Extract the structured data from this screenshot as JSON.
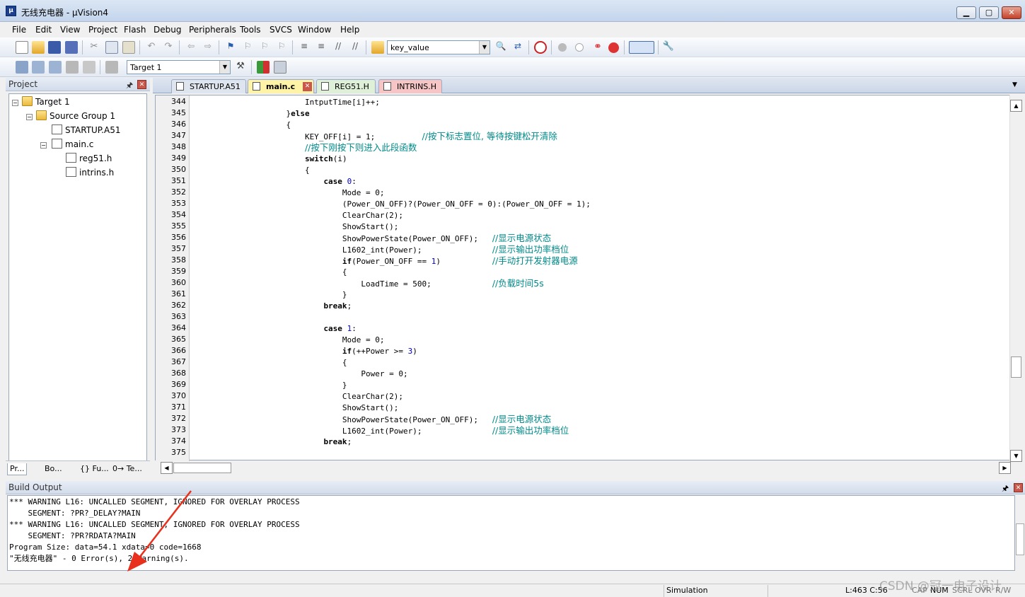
{
  "window": {
    "title": "无线充电器  - µVision4",
    "minimize": "▁",
    "maximize": "▢",
    "close": "✕"
  },
  "menu": [
    "File",
    "Edit",
    "View",
    "Project",
    "Flash",
    "Debug",
    "Peripherals",
    "Tools",
    "SVCS",
    "Window",
    "Help"
  ],
  "toolbar": {
    "find_value": "key_value",
    "target": "Target 1"
  },
  "project": {
    "title": "Project",
    "tree": {
      "target": "Target 1",
      "group": "Source Group 1",
      "file1": "STARTUP.A51",
      "file2": "main.c",
      "inc1": "reg51.h",
      "inc2": "intrins.h"
    },
    "tabs": [
      "Pr...",
      "Bo...",
      "{} Fu...",
      "0→ Te..."
    ]
  },
  "editor": {
    "tabs": [
      "STARTUP.A51",
      "main.c",
      "REG51.H",
      "INTRINS.H"
    ],
    "line_numbers": [
      "344",
      "345",
      "346",
      "347",
      "348",
      "349",
      "350",
      "351",
      "352",
      "353",
      "354",
      "355",
      "356",
      "357",
      "358",
      "359",
      "360",
      "361",
      "362",
      "363",
      "364",
      "365",
      "366",
      "367",
      "368",
      "369",
      "370",
      "371",
      "372",
      "373",
      "374",
      "375"
    ],
    "lines": [
      {
        "code": "                        IntputTime[i]++;",
        "comment": ""
      },
      {
        "code": "                    }else",
        "comment": ""
      },
      {
        "code": "                    {",
        "comment": ""
      },
      {
        "code": "                        KEY_OFF[i] = 1;          ",
        "comment": "//按下标志置位, 等待按键松开清除"
      },
      {
        "code": "                        ",
        "comment": "//按下刚按下则进入此段函数"
      },
      {
        "code": "                        switch(i)",
        "comment": ""
      },
      {
        "code": "                        {",
        "comment": ""
      },
      {
        "code": "                            case 0:",
        "comment": ""
      },
      {
        "code": "                                Mode = 0;",
        "comment": ""
      },
      {
        "code": "                                (Power_ON_OFF)?(Power_ON_OFF = 0):(Power_ON_OFF = 1);",
        "comment": ""
      },
      {
        "code": "                                ClearChar(2);",
        "comment": ""
      },
      {
        "code": "                                ShowStart();",
        "comment": ""
      },
      {
        "code": "                                ShowPowerState(Power_ON_OFF);   ",
        "comment": "//显示电源状态"
      },
      {
        "code": "                                L1602_int(Power);               ",
        "comment": "//显示输出功率档位"
      },
      {
        "code": "                                if(Power_ON_OFF == 1)           ",
        "comment": "//手动打开发射器电源"
      },
      {
        "code": "                                {",
        "comment": ""
      },
      {
        "code": "                                    LoadTime = 500;             ",
        "comment": "//负载时间5s"
      },
      {
        "code": "                                }",
        "comment": ""
      },
      {
        "code": "                            break;",
        "comment": ""
      },
      {
        "code": "",
        "comment": ""
      },
      {
        "code": "                            case 1:",
        "comment": ""
      },
      {
        "code": "                                Mode = 0;",
        "comment": ""
      },
      {
        "code": "                                if(++Power >= 3)",
        "comment": ""
      },
      {
        "code": "                                {",
        "comment": ""
      },
      {
        "code": "                                    Power = 0;",
        "comment": ""
      },
      {
        "code": "                                }",
        "comment": ""
      },
      {
        "code": "                                ClearChar(2);",
        "comment": ""
      },
      {
        "code": "                                ShowStart();",
        "comment": ""
      },
      {
        "code": "                                ShowPowerState(Power_ON_OFF);   ",
        "comment": "//显示电源状态"
      },
      {
        "code": "                                L1602_int(Power);               ",
        "comment": "//显示输出功率档位"
      },
      {
        "code": "                            break;",
        "comment": ""
      },
      {
        "code": "",
        "comment": ""
      }
    ]
  },
  "build": {
    "title": "Build Output",
    "lines": [
      "*** WARNING L16: UNCALLED SEGMENT, IGNORED FOR OVERLAY PROCESS",
      "    SEGMENT: ?PR?_DELAY?MAIN",
      "*** WARNING L16: UNCALLED SEGMENT, IGNORED FOR OVERLAY PROCESS",
      "    SEGMENT: ?PR?RDATA?MAIN",
      "Program Size: data=54.1 xdata=0 code=1668",
      "\"无线充电器\" - 0 Error(s), 2 Warning(s)."
    ]
  },
  "status": {
    "mode": "Simulation",
    "position": "L:463 C:56",
    "caps": "CAP",
    "num": "NUM",
    "scrl": "SCRL",
    "ovr": "OVR",
    "rw": "R/W",
    "watermark": "CSDN @冠一电子设计"
  },
  "colors": {
    "keyword": "#000000",
    "number": "#0000c8",
    "comment": "#008a8a",
    "annotation_arrow": "#e8301c"
  }
}
